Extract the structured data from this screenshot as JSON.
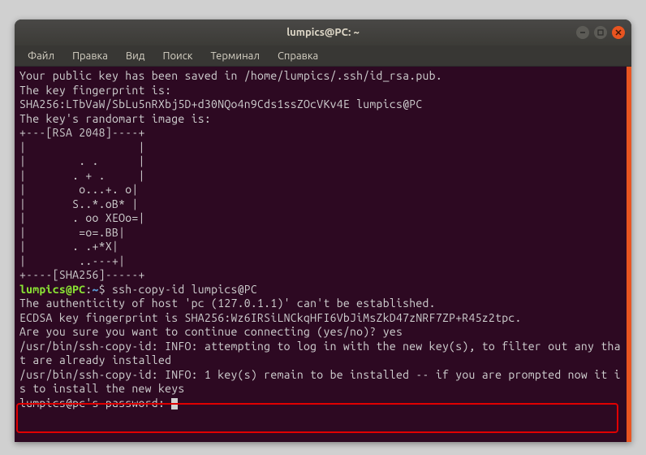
{
  "window": {
    "title": "lumpics@PC: ~"
  },
  "menubar": {
    "items": [
      "Файл",
      "Правка",
      "Вид",
      "Поиск",
      "Терминал",
      "Справка"
    ]
  },
  "terminal": {
    "line1": "Your public key has been saved in /home/lumpics/.ssh/id_rsa.pub.",
    "line2": "The key fingerprint is:",
    "line3": "SHA256:LTbVaW/SbLu5nRXbj5D+d30NQo4n9Cds1ssZOcVKv4E lumpics@PC",
    "line4": "The key's randomart image is:",
    "art1": "+---[RSA 2048]----+",
    "art2": "|                 |",
    "art3": "|        . .      |",
    "art4": "|       . + .     |",
    "art5": "|        o...+. o|",
    "art6": "|       S..*.oB* |",
    "art7": "|       . oo XEOo=|",
    "art8": "|        =o=.BB|",
    "art9": "|       . .+*X|",
    "art10": "|        ..---+|",
    "art11": "+----[SHA256]-----+",
    "prompt_user": "lumpics@PC",
    "prompt_sep": ":",
    "prompt_path": "~",
    "prompt_dollar": "$ ",
    "cmd": "ssh-copy-id lumpics@PC",
    "out1": "The authenticity of host 'pc (127.0.1.1)' can't be established.",
    "out2": "ECDSA key fingerprint is SHA256:Wz6IRSiLNCkqHFI6VbJiMsZkD47zNRF7ZP+R45z2tpc.",
    "out3": "Are you sure you want to continue connecting (yes/no)? yes",
    "out4": "/usr/bin/ssh-copy-id: INFO: attempting to log in with the new key(s), to filter out any that are already installed",
    "out5": "/usr/bin/ssh-copy-id: INFO: 1 key(s) remain to be installed -- if you are prompted now it is to install the new keys",
    "out6": "lumpics@pc's password: "
  }
}
